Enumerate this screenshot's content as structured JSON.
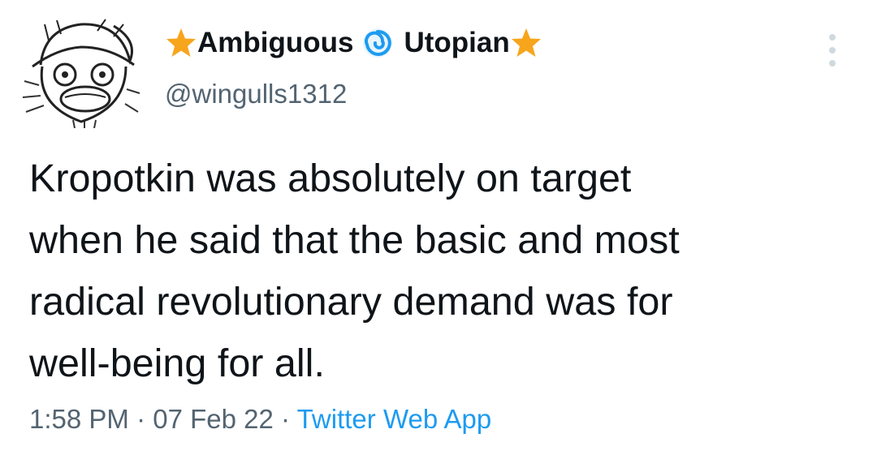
{
  "colors": {
    "text_primary": "#0f1419",
    "text_secondary": "#536471",
    "link": "#1d9bf0",
    "star": "#f7a51c",
    "swirl": "#1d9bf0"
  },
  "author": {
    "avatar_icon": "cartoon-face-avatar",
    "name_part1": "Ambiguous",
    "name_part2": "Utopian",
    "name_icons": [
      "star-emoji-icon",
      "swirl-emoji-icon",
      "star-emoji-icon"
    ],
    "handle": "@wingulls1312"
  },
  "menu_icon": "more-options-icon",
  "tweet": {
    "text": "Kropotkin was absolutely on target\nwhen he said that the basic and most\nradical revolutionary demand was for\nwell-being for all."
  },
  "meta": {
    "time": "1:58 PM",
    "sep1": " · ",
    "date": "07 Feb 22",
    "sep2": " · ",
    "source": "Twitter Web App"
  }
}
